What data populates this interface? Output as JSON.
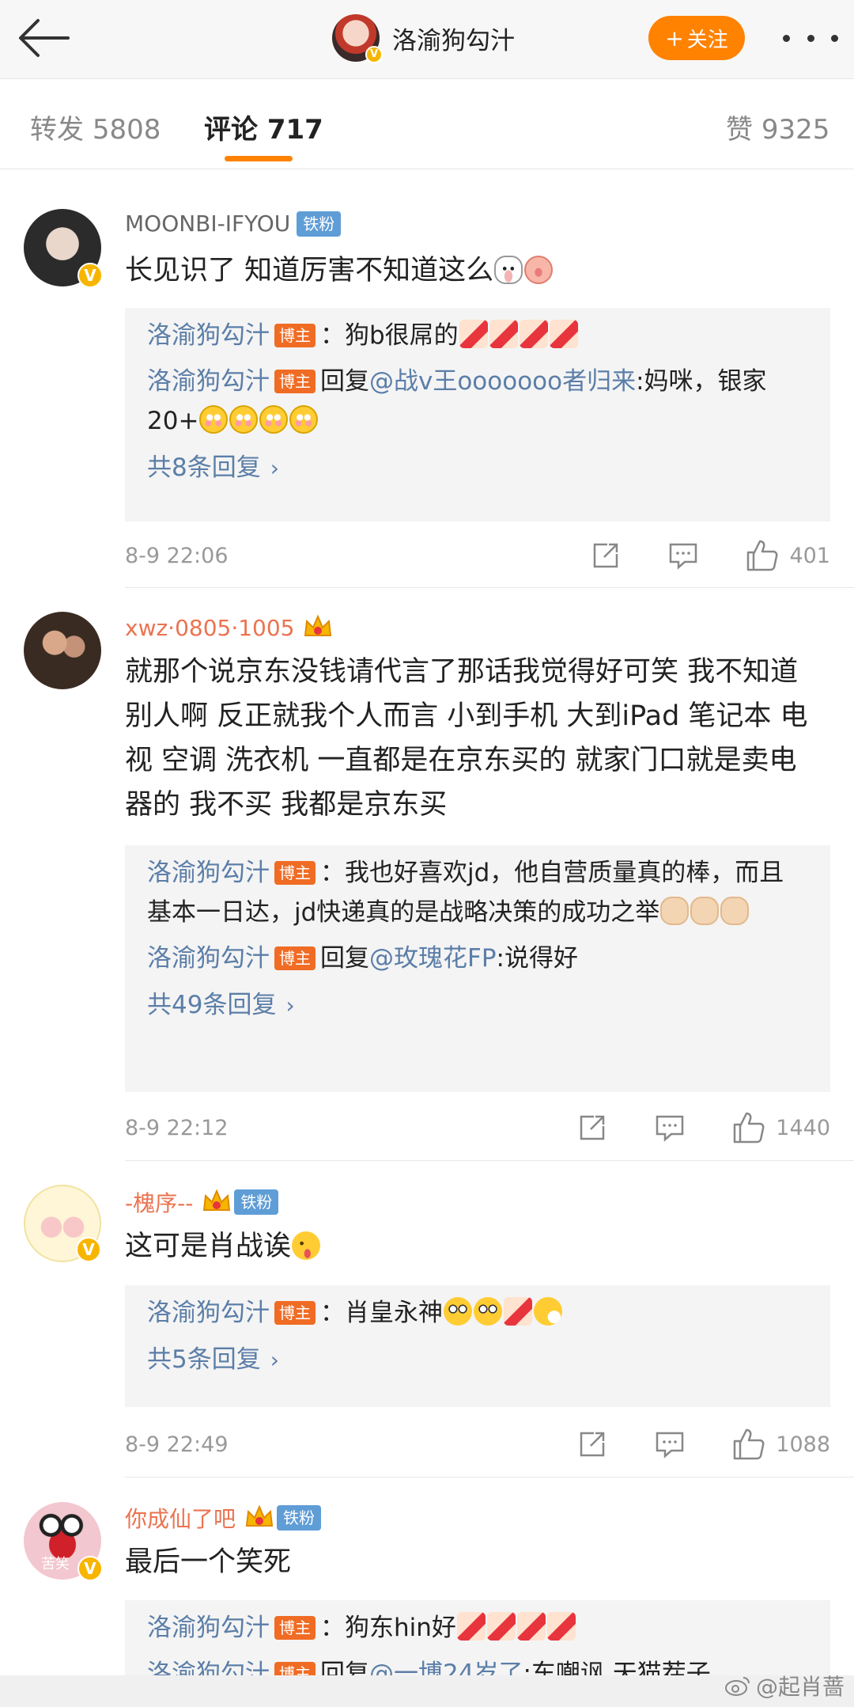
{
  "header": {
    "title": "洛渝狗勾汁",
    "follow_label": "关注",
    "follow_plus": "+",
    "verified_mark": "V"
  },
  "tabs": {
    "repost_label": "转发",
    "repost_count": "5808",
    "comment_label": "评论",
    "comment_count": "717",
    "like_label": "赞",
    "like_count": "9325"
  },
  "comments": [
    {
      "user": "MOONBI-IFYOU",
      "badge": "铁粉",
      "text": "长见识了 知道厉害不知道这么",
      "replies": [
        {
          "name": "洛渝狗勾汁",
          "host": "博主",
          "text": "：狗b很屌的"
        },
        {
          "name": "洛渝狗勾汁",
          "host": "博主",
          "prefix": "回复",
          "mention": "@战v王ooooooo者归来",
          "text": ":妈咪，银家20+"
        }
      ],
      "total_replies": "共8条回复",
      "time": "8-9 22:06",
      "likes": "401"
    },
    {
      "user": "xwz·0805·1005",
      "text": "就那个说京东没钱请代言了那话我觉得好可笑 我不知道别人啊 反正就我个人而言 小到手机 大到iPad 笔记本 电视 空调 洗衣机 一直都是在京东买的 就家门口就是卖电器的 我不买 我都是京东买",
      "replies": [
        {
          "name": "洛渝狗勾汁",
          "host": "博主",
          "text": "：我也好喜欢jd，他自营质量真的棒，而且基本一日达，jd快递真的是战略决策的成功之举"
        },
        {
          "name": "洛渝狗勾汁",
          "host": "博主",
          "prefix": "回复",
          "mention": "@玫瑰花FP",
          "text": ":说得好"
        }
      ],
      "total_replies": "共49条回复",
      "time": "8-9 22:12",
      "likes": "1440"
    },
    {
      "user": "-槐序--",
      "badge": "铁粉",
      "text": "这可是肖战诶",
      "replies": [
        {
          "name": "洛渝狗勾汁",
          "host": "博主",
          "text": "：肖皇永神"
        }
      ],
      "total_replies": "共5条回复",
      "time": "8-9 22:49",
      "likes": "1088"
    },
    {
      "user": "你成仙了吧",
      "badge": "铁粉",
      "text": "最后一个笑死",
      "avatar_caption": "苦笑",
      "replies": [
        {
          "name": "洛渝狗勾汁",
          "host": "博主",
          "text": "：狗东hin好"
        },
        {
          "name": "洛渝狗勾汁",
          "host": "博主",
          "prefix": "回复",
          "mention": "@一博24岁了",
          "text": ":东嘲讽 天猫茬子"
        }
      ]
    }
  ],
  "watermark": "@起肖蔷",
  "colors": {
    "accent": "#ff8200",
    "link": "#5b7ea8",
    "host_badge": "#f06c24",
    "fan_badge": "#5f9dd6",
    "orange_name": "#eb7350"
  }
}
